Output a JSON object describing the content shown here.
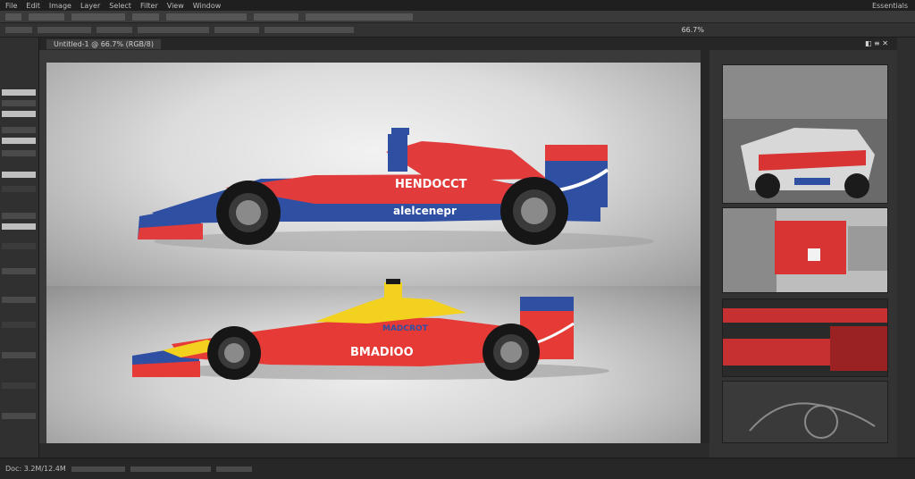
{
  "menubar": {
    "items": [
      "File",
      "Edit",
      "Image",
      "Layer",
      "Select",
      "Filter",
      "View",
      "Window"
    ],
    "right": "Essentials"
  },
  "toolbar": {
    "zoom_label": "66.7%"
  },
  "document": {
    "tab": "Untitled-1 @ 66.7% (RGB/8)"
  },
  "canvas": {
    "car1": {
      "livery_text_1": "HENDOCCT",
      "livery_text_2": "alelcenepr",
      "colors": {
        "primary": "#2f4fa3",
        "accent": "#e23b3b"
      }
    },
    "car2": {
      "livery_text_1": "BMADIOO",
      "livery_text_2": "MADCROT",
      "colors": {
        "primary": "#e63a36",
        "accent": "#f2d21e"
      }
    }
  },
  "right_panel": {
    "icons": [
      "layers-icon",
      "options-icon",
      "close-icon"
    ],
    "thumbnails": [
      "thumb-red-car-rear",
      "thumb-red-car-side",
      "thumb-red-car-detail",
      "thumb-sketch"
    ]
  },
  "status": {
    "doc_info": "Doc: 3.2M/12.4M"
  },
  "colors": {
    "ui_dark": "#2b2b2b",
    "ui_panel": "#333333",
    "canvas_bg": "#dcdcdc"
  }
}
